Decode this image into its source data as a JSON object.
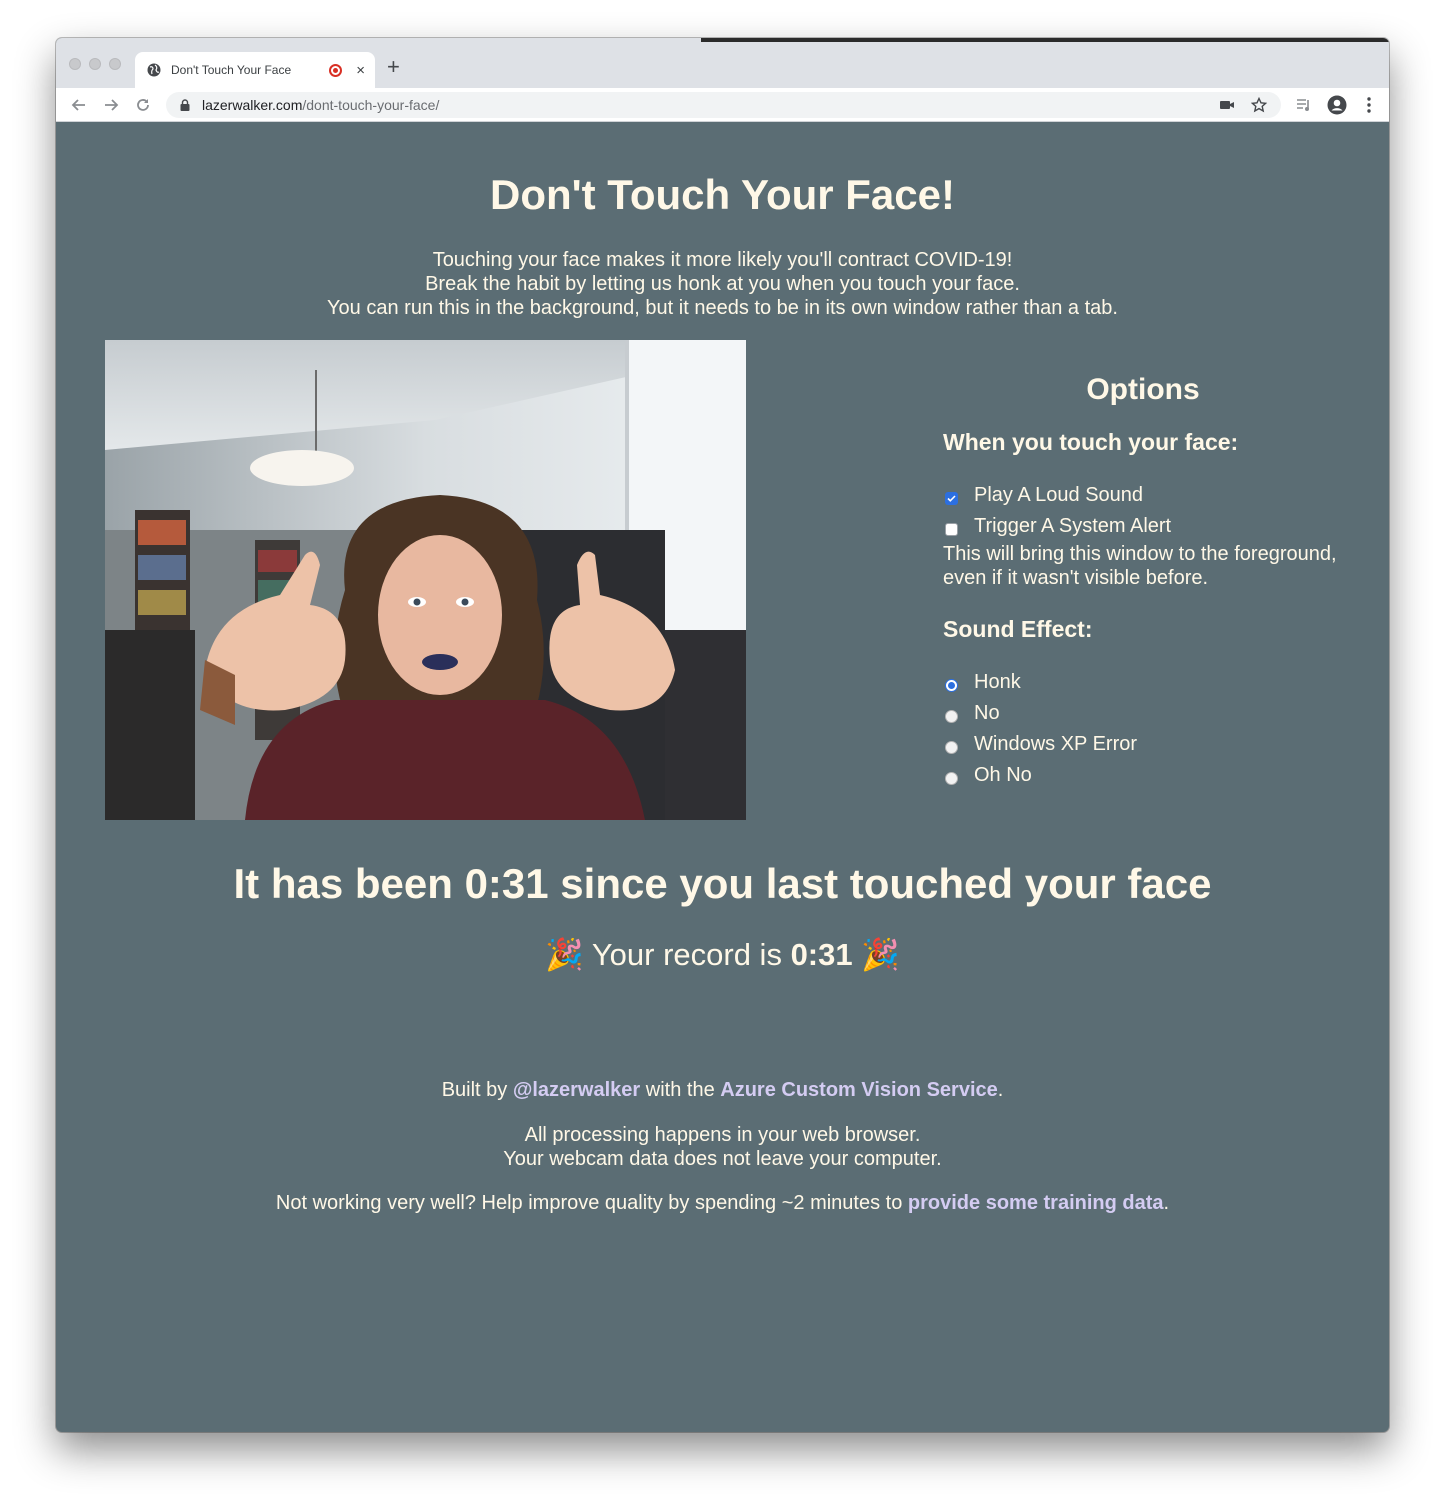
{
  "browser": {
    "tab_title": "Don't Touch Your Face",
    "new_tab_label": "+",
    "close_label": "×",
    "url_host": "lazerwalker.com",
    "url_path": "/dont-touch-your-face/"
  },
  "page": {
    "title": "Don't Touch Your Face!",
    "intro_lines": [
      "Touching your face makes it more likely you'll contract COVID-19!",
      "Break the habit by letting us honk at you when you touch your face.",
      "You can run this in the background, but it needs to be in its own window rather than a tab."
    ],
    "webcam_alt": "webcam-feed"
  },
  "options": {
    "title": "Options",
    "touch_heading": "When you touch your face:",
    "touch_actions": [
      {
        "label": "Play A Loud Sound",
        "checked": true
      },
      {
        "label": "Trigger A System Alert",
        "checked": false
      }
    ],
    "alert_note": "This will bring this window to the foreground, even if it wasn't visible before.",
    "sound_heading": "Sound Effect:",
    "sounds": [
      {
        "label": "Honk",
        "selected": true
      },
      {
        "label": "No",
        "selected": false
      },
      {
        "label": "Windows XP Error",
        "selected": false
      },
      {
        "label": "Oh No",
        "selected": false
      }
    ]
  },
  "status": {
    "since_prefix": "It has been ",
    "since_time": "0:31",
    "since_suffix": " since you last touched your face",
    "record_prefix": "Your record is ",
    "record_time": "0:31",
    "party_emoji": "🎉"
  },
  "footer": {
    "built_by": "Built by ",
    "author_link": "@lazerwalker",
    "with_the": " with the ",
    "service_link": "Azure Custom Vision Service",
    "period": ".",
    "privacy_line1": "All processing happens in your web browser.",
    "privacy_line2": "Your webcam data does not leave your computer.",
    "training_prefix": "Not working very well? Help improve quality by spending ~2 minutes to ",
    "training_link": "provide some training data",
    "training_suffix": "."
  },
  "colors": {
    "page_bg": "#5b6d74",
    "text": "#fff8e7",
    "link": "#d4ccf2",
    "accent": "#2c6fe0",
    "record_red": "#d93025"
  }
}
